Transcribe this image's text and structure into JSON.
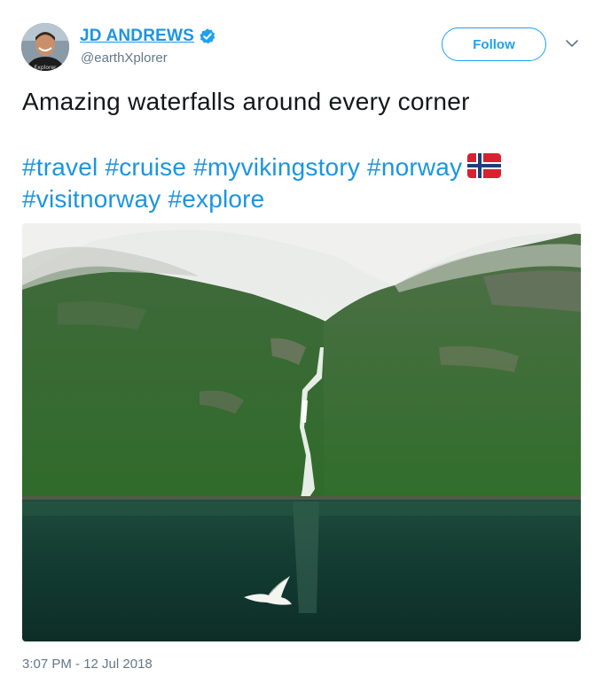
{
  "author": {
    "display_name": "JD ANDREWS",
    "handle": "@earthXplorer",
    "verified": true,
    "avatar_text": "Explorer"
  },
  "header": {
    "follow_label": "Follow"
  },
  "tweet": {
    "text": "Amazing waterfalls around every corner",
    "hashtags": [
      "#travel",
      "#cruise",
      "#myvikingstory",
      "#norway",
      "#visitnorway",
      "#explore"
    ],
    "emoji": "flag-norway",
    "timestamp": "3:07 PM - 12 Jul 2018"
  },
  "colors": {
    "link": "#1b95e0",
    "follow_border": "#1da1f2",
    "muted": "#657786",
    "text": "#14171a"
  },
  "icons": [
    "verified-badge-icon",
    "chevron-down-icon",
    "flag-norway-icon"
  ]
}
